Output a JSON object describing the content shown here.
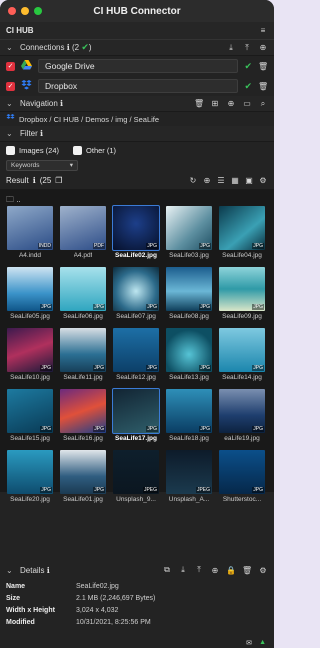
{
  "app": {
    "title": "CI HUB Connector",
    "name": "CI HUB"
  },
  "colors": {
    "accent": "#3b7bd6",
    "ok": "#38c25a",
    "check": "#e0313e"
  },
  "connections": {
    "label": "Connections",
    "count": "(2",
    "count_end": ")",
    "items": [
      {
        "name": "Google Drive",
        "icon": "google-drive-icon"
      },
      {
        "name": "Dropbox",
        "icon": "dropbox-icon"
      }
    ]
  },
  "navigation": {
    "label": "Navigation",
    "path": "Dropbox / CI HUB / Demos / img / SeaLife"
  },
  "filter": {
    "label": "Filter",
    "options": [
      {
        "label": "Images (24)",
        "checked": true
      },
      {
        "label": "Other (1)",
        "checked": false
      }
    ],
    "dropdown": "Keywords"
  },
  "result": {
    "label": "Result",
    "count": "(25"
  },
  "folder_up": "..",
  "files": [
    {
      "name": "A4.indd",
      "badge": "INDD"
    },
    {
      "name": "A4.pdf",
      "badge": "PDF"
    },
    {
      "name": "SeaLife02.jpg",
      "badge": "JPG"
    },
    {
      "name": "SeaLife03.jpg",
      "badge": "JPG"
    },
    {
      "name": "SeaLife04.jpg",
      "badge": "JPG"
    },
    {
      "name": "SeaLife05.jpg",
      "badge": "JPG"
    },
    {
      "name": "SeaLife06.jpg",
      "badge": "JPG"
    },
    {
      "name": "SeaLife07.jpg",
      "badge": "JPG"
    },
    {
      "name": "SeaLife08.jpg",
      "badge": "JPG"
    },
    {
      "name": "SeaLife09.jpg",
      "badge": "JPG"
    },
    {
      "name": "SeaLife10.jpg",
      "badge": "JPG"
    },
    {
      "name": "SeaLife11.jpg",
      "badge": "JPG"
    },
    {
      "name": "SeaLife12.jpg",
      "badge": "JPG"
    },
    {
      "name": "SeaLife13.jpg",
      "badge": "JPG"
    },
    {
      "name": "SeaLife14.jpg",
      "badge": "JPG"
    },
    {
      "name": "SeaLife15.jpg",
      "badge": "JPG"
    },
    {
      "name": "SeaLife16.jpg",
      "badge": "JPG"
    },
    {
      "name": "SeaLife17.jpg",
      "badge": "JPG"
    },
    {
      "name": "SeaLife18.jpg",
      "badge": "JPG"
    },
    {
      "name": "eaLife19.jpg",
      "badge": "JPG"
    },
    {
      "name": "SeaLife20.jpg",
      "badge": "JPG"
    },
    {
      "name": "SeaLife01.jpg",
      "badge": "JPG"
    },
    {
      "name": "Unsplash_9...",
      "badge": "JPEG"
    },
    {
      "name": "Unsplash_A...",
      "badge": "JPEG"
    },
    {
      "name": "Shutterstoc...",
      "badge": "JPG"
    }
  ],
  "details": {
    "label": "Details",
    "rows": [
      {
        "key": "Name",
        "value": "SeaLife02.jpg"
      },
      {
        "key": "Size",
        "value": "2.1 MB (2,246,697 Bytes)"
      },
      {
        "key": "Width x Height",
        "value": "3,024 x 4,032"
      },
      {
        "key": "Modified",
        "value": "10/31/2021, 8:25:56 PM"
      }
    ]
  }
}
